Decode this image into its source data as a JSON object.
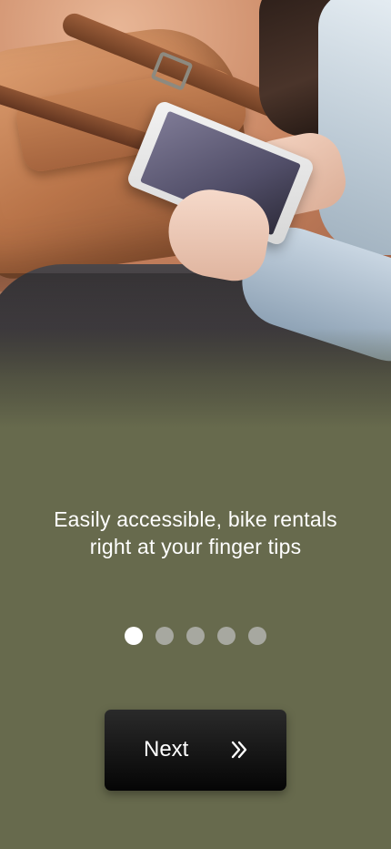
{
  "onboarding": {
    "hero_image": "woman-using-phone-with-bag-photo",
    "tagline": "Easily accessible, bike rentals right at your finger tips",
    "pager": {
      "total": 5,
      "active_index": 0
    },
    "next_button": {
      "label": "Next",
      "icon": "double-chevron-right-icon"
    }
  },
  "colors": {
    "background": "#676a4d",
    "button": "#111111",
    "text": "#ffffff",
    "dot_active": "#ffffff",
    "dot_inactive": "#a7a8a0"
  }
}
